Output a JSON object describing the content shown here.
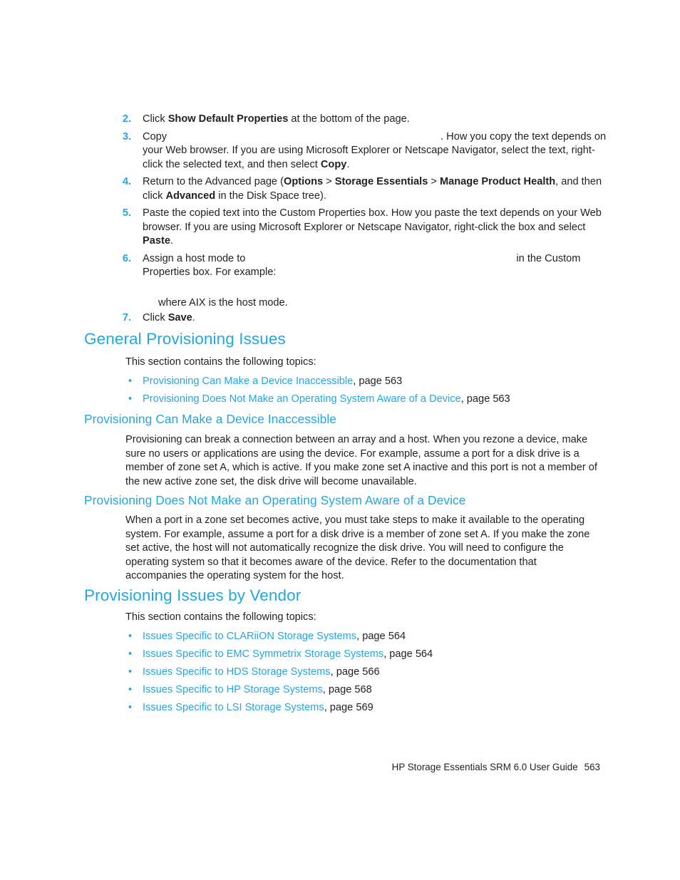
{
  "document": {
    "title": "HP Storage Essentials SRM 6.0 User Guide",
    "page_number": "563",
    "accent_color": "#22a7e0",
    "text_color": "#231f20"
  },
  "steps": [
    {
      "number": "2.",
      "parts": [
        {
          "type": "text",
          "value": "Click "
        },
        {
          "type": "bold",
          "value": "Show Default Properties"
        },
        {
          "type": "text",
          "value": " at the bottom of the page."
        }
      ],
      "plain": "Click Show Default Properties at the bottom of the page."
    },
    {
      "number": "3.",
      "parts": [
        {
          "type": "text",
          "value": "Copy "
        },
        {
          "type": "gap",
          "value": ""
        },
        {
          "type": "text",
          "value": ". How you copy the text depends on your Web browser. If you are using Microsoft Explorer or Netscape Navigator, select the text, right-click the selected text, and then select "
        },
        {
          "type": "bold",
          "value": "Copy"
        },
        {
          "type": "text",
          "value": "."
        }
      ],
      "plain": "Copy . How you copy the text depends on your Web browser. If you are using Microsoft Explorer or Netscape Navigator, select the text, right-click the selected text, and then select Copy."
    },
    {
      "number": "4.",
      "parts": [
        {
          "type": "text",
          "value": "Return to the Advanced page ("
        },
        {
          "type": "bold",
          "value": "Options"
        },
        {
          "type": "text",
          "value": " > "
        },
        {
          "type": "bold",
          "value": "Storage Essentials"
        },
        {
          "type": "text",
          "value": " > "
        },
        {
          "type": "bold",
          "value": "Manage Product Health"
        },
        {
          "type": "text",
          "value": ", and then click "
        },
        {
          "type": "bold",
          "value": "Advanced"
        },
        {
          "type": "text",
          "value": " in the Disk Space tree)."
        }
      ],
      "plain": "Return to the Advanced page (Options > Storage Essentials > Manage Product Health, and then click Advanced in the Disk Space tree)."
    },
    {
      "number": "5.",
      "parts": [
        {
          "type": "text",
          "value": "Paste the copied text into the Custom Properties box. How you paste the text depends on your Web browser. If you are using Microsoft Explorer or Netscape Navigator, right-click the box and select "
        },
        {
          "type": "bold",
          "value": "Paste"
        },
        {
          "type": "text",
          "value": "."
        }
      ],
      "plain": "Paste the copied text into the Custom Properties box. How you paste the text depends on your Web browser. If you are using Microsoft Explorer or Netscape Navigator, right-click the box and select Paste."
    },
    {
      "number": "6.",
      "parts": [
        {
          "type": "text",
          "value": "Assign a host mode to "
        },
        {
          "type": "gap",
          "value": ""
        },
        {
          "type": "text",
          "value": " in the Custom Properties box. For example:"
        }
      ],
      "plain": "Assign a host mode to  in the Custom Properties box. For example:",
      "note": "where AIX is the host mode."
    },
    {
      "number": "7.",
      "parts": [
        {
          "type": "text",
          "value": "Click "
        },
        {
          "type": "bold",
          "value": "Save"
        },
        {
          "type": "text",
          "value": "."
        }
      ],
      "plain": "Click Save."
    }
  ],
  "sections": [
    {
      "heading": "General Provisioning Issues",
      "intro": "This section contains the following topics:",
      "topics": [
        {
          "link": "Provisioning Can Make a Device Inaccessible",
          "page": ", page 563"
        },
        {
          "link": "Provisioning Does Not Make an Operating System Aware of a Device",
          "page": ", page 563"
        }
      ]
    },
    {
      "heading": "Provisioning Issues by Vendor",
      "intro": "This section contains the following topics:",
      "topics": [
        {
          "link": "Issues Specific to CLARiiON Storage Systems",
          "page": ", page 564"
        },
        {
          "link": "Issues Specific to EMC Symmetrix Storage Systems",
          "page": ", page 564"
        },
        {
          "link": "Issues Specific to HDS Storage Systems",
          "page": ", page 566"
        },
        {
          "link": "Issues Specific to HP Storage Systems",
          "page": ", page 568"
        },
        {
          "link": "Issues Specific to LSI Storage Systems",
          "page": ", page 569"
        }
      ]
    }
  ],
  "subsections": [
    {
      "heading": "Provisioning Can Make a Device Inaccessible",
      "body": "Provisioning can break a connection between an array and a host. When you rezone a device, make sure no users or applications are using the device. For example, assume a port for a disk drive is a member of zone set A, which is active. If you make zone set A inactive and this port is not a member of the new active zone set, the disk drive will become unavailable."
    },
    {
      "heading": "Provisioning Does Not Make an Operating System Aware of a Device",
      "body": "When a port in a zone set becomes active, you must take steps to make it available to the operating system. For example, assume a port for a disk drive is a member of zone set A. If you make the zone set active, the host will not automatically recognize the disk drive. You will need to configure the operating system so that it becomes aware of the device. Refer to the documentation that accompanies the operating system for the host."
    }
  ],
  "bullet_glyph": "•"
}
